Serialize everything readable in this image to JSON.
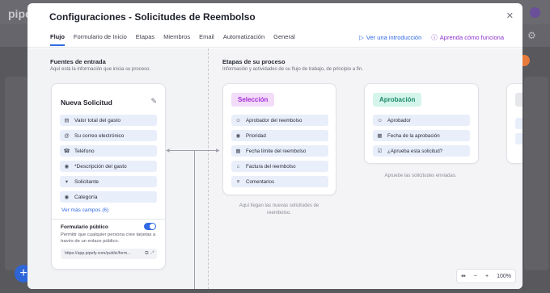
{
  "background": {
    "logo": "pipefy",
    "fab_label": "+",
    "gear_glyph": "⚙"
  },
  "modal": {
    "title": "Configuraciones - Solicitudes de Reembolso",
    "close_glyph": "✕",
    "tabs": [
      {
        "label": "Flujo",
        "active": true
      },
      {
        "label": "Formulario de Inicio",
        "active": false
      },
      {
        "label": "Etapas",
        "active": false
      },
      {
        "label": "Miembros",
        "active": false
      },
      {
        "label": "Email",
        "active": false
      },
      {
        "label": "Automatización",
        "active": false
      },
      {
        "label": "General",
        "active": false
      }
    ],
    "links": {
      "intro": "Ver una introducción",
      "how": "Aprenda cómo funciona"
    }
  },
  "entry": {
    "title": "Fuentes de entrada",
    "subtitle": "Aquí está la información que inicia su proceso.",
    "card_title": "Nueva Solicitud",
    "fields": [
      {
        "icon": "calendar-field-icon",
        "glyph": "▤",
        "label": "Valor total del gasto"
      },
      {
        "icon": "email-icon",
        "glyph": "@",
        "label": "Su correo electrónico"
      },
      {
        "icon": "phone-icon",
        "glyph": "☎",
        "label": "Teléfono"
      },
      {
        "icon": "radio-icon",
        "glyph": "◉",
        "label": "*Descripción del gasto"
      },
      {
        "icon": "select-icon",
        "glyph": "▾",
        "label": "Solicitante"
      },
      {
        "icon": "radio-icon",
        "glyph": "◉",
        "label": "Categoría"
      }
    ],
    "more_fields": "Ver más campos (6)",
    "public_form": {
      "title": "Formulario público",
      "description": "Permitir que cualquier persona cree tarjetas a través de un enlace público.",
      "url": "https://app.pipefy.com/public/form..."
    }
  },
  "process": {
    "title": "Etapas de su proceso",
    "subtitle": "Información y actividades de su flujo de trabajo, de principio a fin.",
    "phases": [
      {
        "name": "Selección",
        "badge_bg": "#f3dcfa",
        "badge_color": "#a32bd6",
        "fields": [
          {
            "glyph": "☺",
            "label": "Aprobador del reembolso"
          },
          {
            "glyph": "◉",
            "label": "Prioridad"
          },
          {
            "glyph": "▦",
            "label": "Fecha límite del reembolso"
          },
          {
            "glyph": "⌂",
            "label": "Factura del reembolso"
          },
          {
            "glyph": "≡",
            "label": "Comentarios"
          }
        ],
        "description": "Aquí llegan las nuevas solicitudes de reembolso."
      },
      {
        "name": "Aprobación",
        "badge_bg": "#d5f5ec",
        "badge_color": "#1d8a6a",
        "fields": [
          {
            "glyph": "☺",
            "label": "Aprobador"
          },
          {
            "glyph": "▦",
            "label": "Fecha de la aprobación"
          },
          {
            "glyph": "☑",
            "label": "¿Aprueba esta solicitud?"
          }
        ],
        "description": "Apruebe las solicitudes enviadas."
      }
    ]
  },
  "zoom": {
    "fit_glyph": "⇹",
    "minus": "−",
    "plus": "+",
    "level": "100%"
  }
}
